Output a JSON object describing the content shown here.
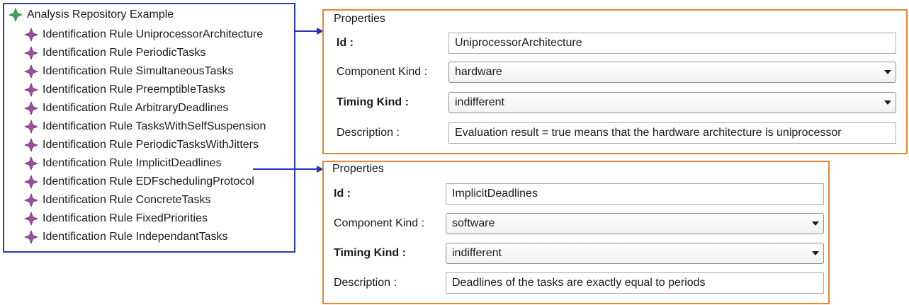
{
  "tree": {
    "root_label": "Analysis Repository Example",
    "items": [
      {
        "label": "Identification Rule UniprocessorArchitecture"
      },
      {
        "label": "Identification Rule PeriodicTasks"
      },
      {
        "label": "Identification Rule SimultaneousTasks"
      },
      {
        "label": "Identification Rule PreemptibleTasks"
      },
      {
        "label": "Identification Rule ArbitraryDeadlines"
      },
      {
        "label": "Identification Rule TasksWithSelfSuspension"
      },
      {
        "label": "Identification Rule PeriodicTasksWithJitters"
      },
      {
        "label": "Identification Rule ImplicitDeadlines"
      },
      {
        "label": "Identification Rule EDFschedulingProtocol"
      },
      {
        "label": "Identification Rule ConcreteTasks"
      },
      {
        "label": "Identification Rule FixedPriorities"
      },
      {
        "label": "Identification Rule IndependantTasks"
      }
    ],
    "root_icon": "green-diamond-icon",
    "item_icon": "purple-diamond-icon"
  },
  "panels": [
    {
      "title": "Properties",
      "id_label": "Id :",
      "id_value": "UniprocessorArchitecture",
      "component_kind_label": "Component Kind :",
      "component_kind_value": "hardware",
      "timing_kind_label": "Timing Kind :",
      "timing_kind_value": "indifferent",
      "description_label": "Description :",
      "description_value": "Evaluation result = true means that the hardware architecture is uniprocessor"
    },
    {
      "title": "Properties",
      "id_label": "Id :",
      "id_value": "ImplicitDeadlines",
      "component_kind_label": "Component Kind :",
      "component_kind_value": "software",
      "timing_kind_label": "Timing Kind :",
      "timing_kind_value": "indifferent",
      "description_label": "Description :",
      "description_value": "Deadlines of the tasks are exactly equal to periods"
    }
  ],
  "colors": {
    "tree_border": "#2d3caa",
    "panel_border": "#e6862f",
    "arrow": "#2233bb",
    "item_icon": "#9b4f9b",
    "root_icon": "#3fa35a"
  }
}
